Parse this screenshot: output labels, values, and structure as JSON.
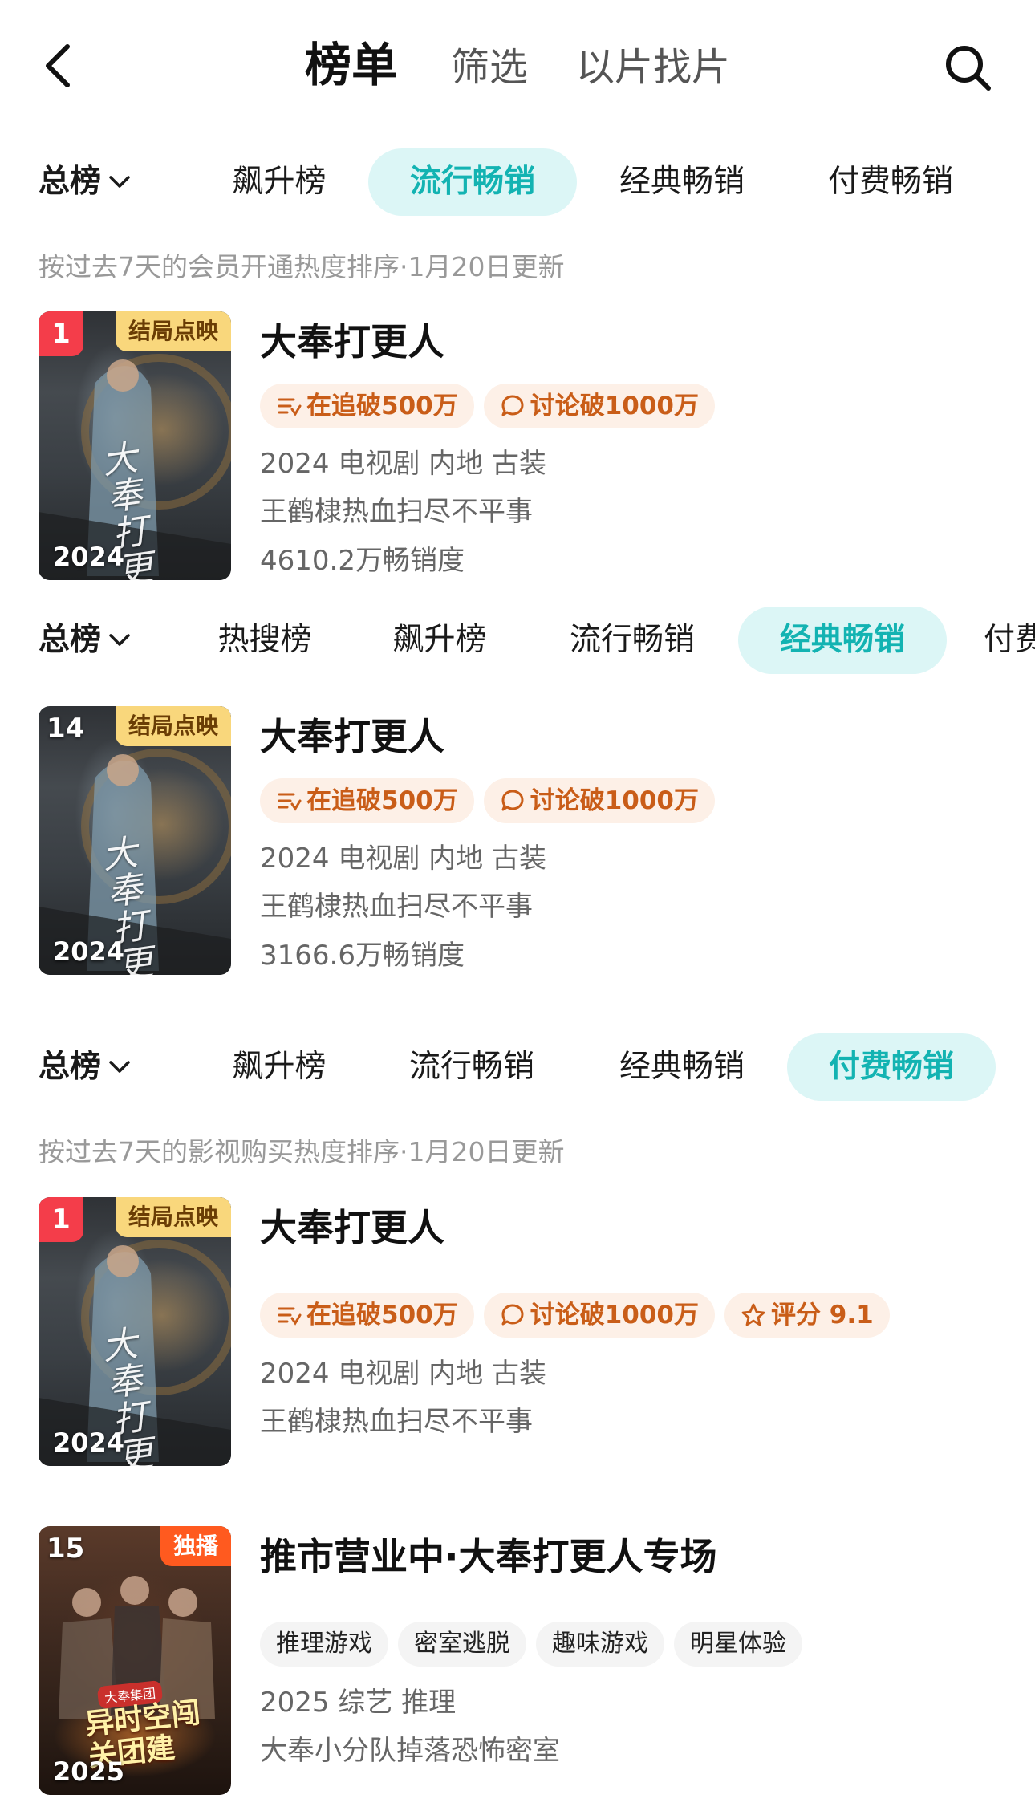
{
  "header": {
    "title": "榜单",
    "tabs": [
      "筛选",
      "以片找片"
    ]
  },
  "colors": {
    "accent": "#13b3b2",
    "accent_bg": "#dcf6f6",
    "chip_bg": "#fdf0e7",
    "chip_text": "#c95d18",
    "rank_red": "#f43d4a",
    "tag_gold": "#f9d77c",
    "tag_orange": "#ff5a1f"
  },
  "sections": [
    {
      "tabs": {
        "total": "总榜",
        "items": [
          "飙升榜",
          "流行畅销",
          "经典畅销",
          "付费畅销"
        ],
        "active": "流行畅销"
      },
      "note": "按过去7天的会员开通热度排序·1月20日更新",
      "item": {
        "rank": "1",
        "corner_tag": "结局点映",
        "year": "2024",
        "poster_calligraphy": "大奉打更人",
        "title": "大奉打更人",
        "chips": [
          {
            "icon": "list-icon",
            "label": "在追破500万"
          },
          {
            "icon": "comment-icon",
            "label": "讨论破1000万"
          }
        ],
        "meta": [
          "2024 电视剧 内地 古装",
          "王鹤棣热血扫尽不平事",
          "4610.2万畅销度"
        ]
      }
    },
    {
      "tabs": {
        "total": "总榜",
        "items": [
          "热搜榜",
          "飙升榜",
          "流行畅销",
          "经典畅销",
          "付费畅销"
        ],
        "active": "经典畅销"
      },
      "item": {
        "rank": "14",
        "corner_tag": "结局点映",
        "year": "2024",
        "poster_calligraphy": "大奉打更人",
        "title": "大奉打更人",
        "chips": [
          {
            "icon": "list-icon",
            "label": "在追破500万"
          },
          {
            "icon": "comment-icon",
            "label": "讨论破1000万"
          }
        ],
        "meta": [
          "2024 电视剧 内地 古装",
          "王鹤棣热血扫尽不平事",
          "3166.6万畅销度"
        ]
      }
    },
    {
      "tabs": {
        "total": "总榜",
        "items": [
          "飙升榜",
          "流行畅销",
          "经典畅销",
          "付费畅销"
        ],
        "active": "付费畅销"
      },
      "note": "按过去7天的影视购买热度排序·1月20日更新",
      "items": [
        {
          "rank": "1",
          "corner_tag": "结局点映",
          "year": "2024",
          "poster_calligraphy": "大奉打更人",
          "title": "大奉打更人",
          "chips": [
            {
              "icon": "list-icon",
              "label": "在追破500万"
            },
            {
              "icon": "comment-icon",
              "label": "讨论破1000万"
            },
            {
              "icon": "star-icon",
              "label": "评分 9.1"
            }
          ],
          "meta": [
            "2024 电视剧 内地 古装",
            "王鹤棣热血扫尽不平事"
          ]
        },
        {
          "rank": "15",
          "corner_tag": "独播",
          "year": "2025",
          "poster_badge": "大奉集团",
          "poster_text": "异时空闯关团建",
          "title": "推市营业中·大奉打更人专场",
          "tags": [
            "推理游戏",
            "密室逃脱",
            "趣味游戏",
            "明星体验"
          ],
          "meta": [
            "2025 综艺 推理",
            "大奉小分队掉落恐怖密室"
          ]
        }
      ]
    }
  ]
}
